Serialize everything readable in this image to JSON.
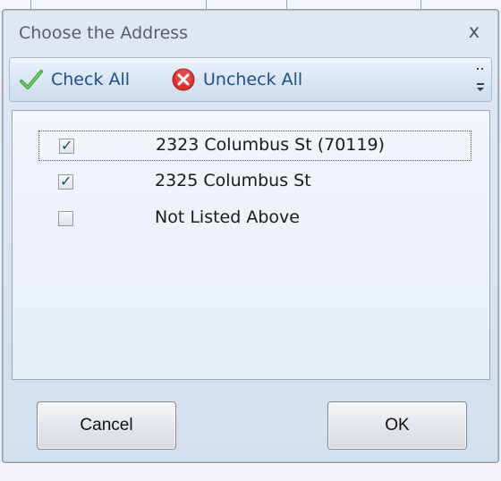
{
  "dialog": {
    "title": "Choose the Address",
    "close_glyph": "x"
  },
  "toolbar": {
    "check_all_label": "Check All",
    "uncheck_all_label": "Uncheck All",
    "check_icon": "green-checkmark-icon",
    "uncheck_icon": "red-x-circle-icon",
    "accent_color": "#1f4f86"
  },
  "addresses": [
    {
      "label": "2323 Columbus St (70119)",
      "checked": true,
      "focused": true
    },
    {
      "label": "2325 Columbus St",
      "checked": true,
      "focused": false
    },
    {
      "label": "Not Listed Above",
      "checked": false,
      "focused": false
    }
  ],
  "buttons": {
    "cancel_label": "Cancel",
    "ok_label": "OK"
  }
}
